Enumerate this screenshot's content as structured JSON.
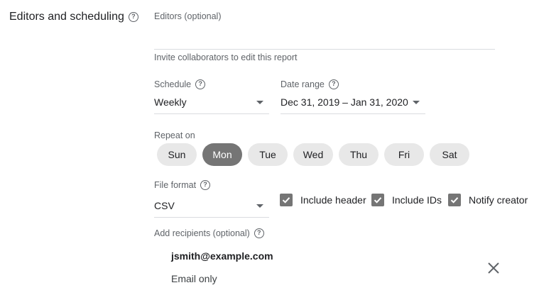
{
  "section": {
    "title": "Editors and scheduling",
    "help_icon": "help-circle-icon"
  },
  "editors": {
    "label": "Editors (optional)",
    "value": "",
    "hint": "Invite collaborators to edit this report"
  },
  "schedule": {
    "label": "Schedule",
    "value": "Weekly"
  },
  "date_range": {
    "label": "Date range",
    "value": "Dec 31, 2019 – Jan 31, 2020"
  },
  "repeat": {
    "label": "Repeat on",
    "days": [
      {
        "label": "Sun",
        "selected": false
      },
      {
        "label": "Mon",
        "selected": true
      },
      {
        "label": "Tue",
        "selected": false
      },
      {
        "label": "Wed",
        "selected": false
      },
      {
        "label": "Thu",
        "selected": false
      },
      {
        "label": "Fri",
        "selected": false
      },
      {
        "label": "Sat",
        "selected": false
      }
    ]
  },
  "file_format": {
    "label": "File format",
    "value": "CSV"
  },
  "options": [
    {
      "label": "Include header",
      "checked": true
    },
    {
      "label": "Include IDs",
      "checked": true
    },
    {
      "label": "Notify creator",
      "checked": true
    }
  ],
  "recipients": {
    "label": "Add recipients (optional)",
    "items": [
      {
        "email": "jsmith@example.com",
        "type": "Email only"
      }
    ]
  },
  "colors": {
    "selected_chip": "#757575",
    "chip": "#e8e8e8",
    "checkbox": "#757575",
    "divider": "#dadce0"
  }
}
